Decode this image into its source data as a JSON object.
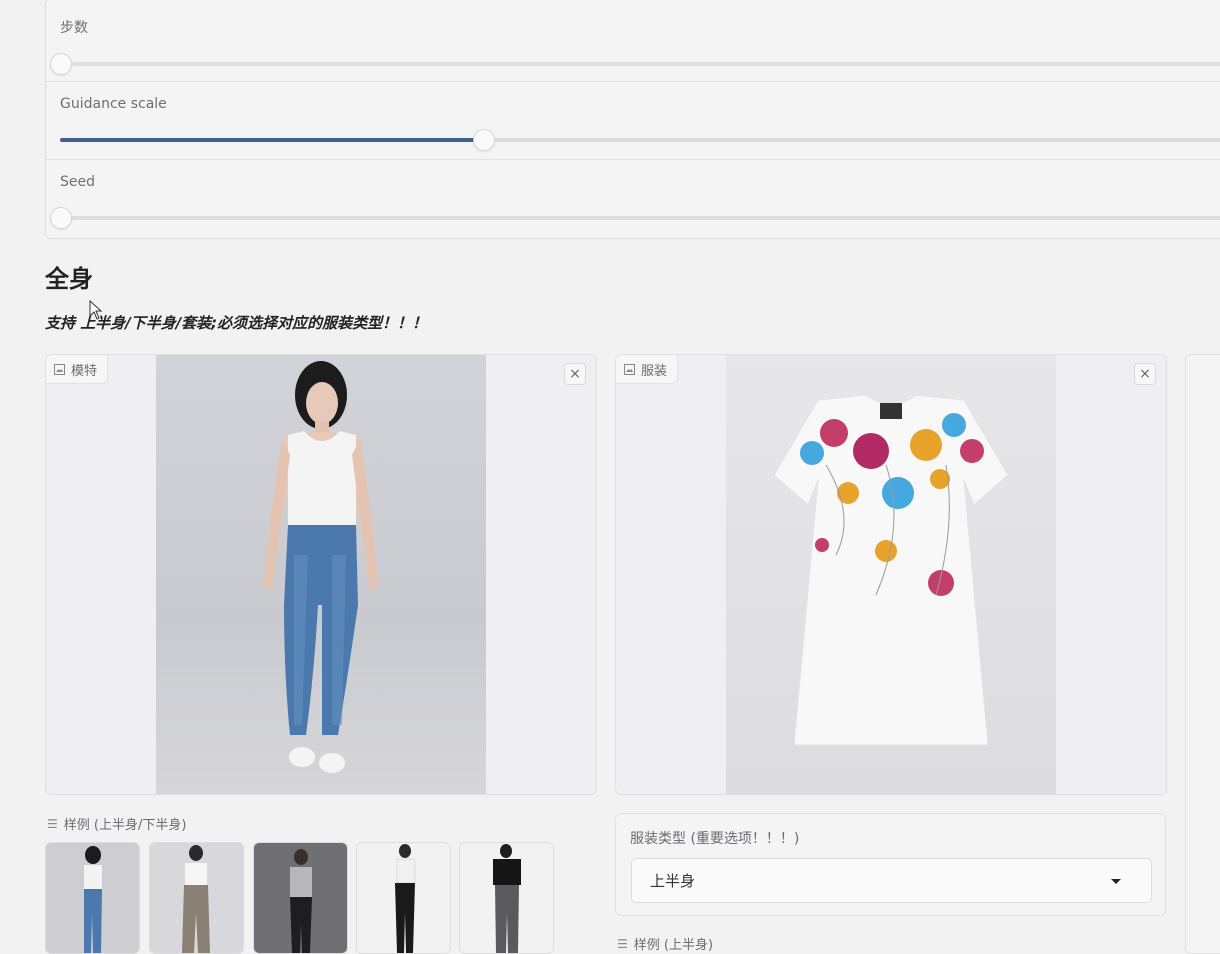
{
  "sliders": [
    {
      "label": "步数",
      "value_fraction": 0.0
    },
    {
      "label": "Guidance scale",
      "value_fraction": 0.36
    },
    {
      "label": "Seed",
      "value_fraction": 0.0
    }
  ],
  "section": {
    "title": "全身",
    "subtitle": "支持 上半身/下半身/套装;必须选择对应的服装类型！！！"
  },
  "model_panel": {
    "label": "模特",
    "close": "×",
    "icon": "image-icon"
  },
  "garment_panel": {
    "label": "服装",
    "close": "×",
    "icon": "image-icon"
  },
  "model_examples": {
    "label": "样例 (上半身/下半身)",
    "icon": "list-icon",
    "count": 5
  },
  "garment_type": {
    "label": "服装类型 (重要选项！！！)",
    "selected": "上半身"
  },
  "garment_examples": {
    "label": "样例 (上半身)"
  },
  "colors": {
    "accent": "#3e5f8f",
    "background": "#f2f2f3",
    "panel_border": "#dcdcdf"
  }
}
